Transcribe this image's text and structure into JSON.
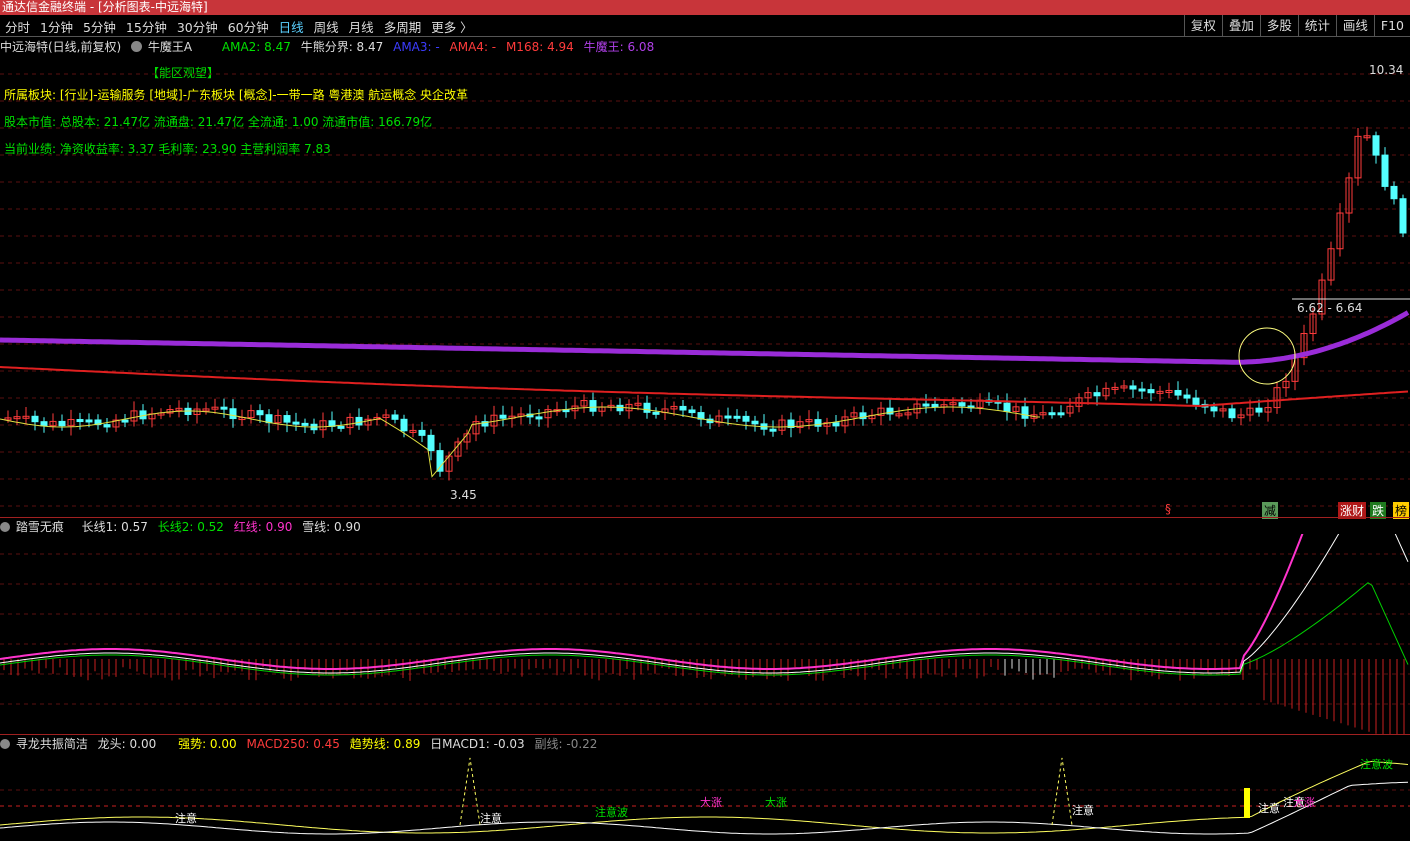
{
  "window": {
    "title": "通达信金融终端 - [分析图表-中远海特]"
  },
  "periods": [
    "分时",
    "1分钟",
    "5分钟",
    "15分钟",
    "30分钟",
    "60分钟",
    "日线",
    "周线",
    "月线",
    "多周期",
    "更多 〉"
  ],
  "active_period": "日线",
  "tools": [
    "复权",
    "叠加",
    "多股",
    "统计",
    "画线",
    "F10"
  ],
  "main_legend": {
    "stock": "中远海特(日线,前复权)",
    "indicator_icon": "circle-chevron-icon",
    "indicator": "牛魔王A",
    "ama2": "AMA2: 8.47",
    "bull_line": "牛熊分界: 8.47",
    "ama3": "AMA3: -",
    "ama4": "AMA4: -",
    "m168": "M168: 4.94",
    "niumowang": "牛魔王: 6.08"
  },
  "info": {
    "tag": "【能区观望】",
    "sector": "所属板块: [行业]-运输服务 [地域]-广东板块 [概念]-一带一路 粤港澳 航运概念 央企改革",
    "capital": "股本市值: 总股本: 21.47亿 流通盘: 21.47亿 全流通: 1.00 流通市值: 166.79亿",
    "performance": "当前业绩:  净资收益率: 3.37 毛利率: 23.90 主营利润率 7.83"
  },
  "annotations": {
    "high": "10.34",
    "low": "3.45",
    "range": "6.62 - 6.64",
    "marker_s": "§",
    "badge_jian": "减",
    "badge_zhangcai": "涨财",
    "badge_die": "跌",
    "badge_bang": "榜"
  },
  "ind1": {
    "name": "踏雪无痕",
    "l1": "长线1: 0.57",
    "l2": "长线2: 0.52",
    "red": "红线: 0.90",
    "snow": "雪线: 0.90"
  },
  "ind2": {
    "name": "寻龙共振简洁",
    "longhead": "龙头: 0.00",
    "strong": "强势: 0.00",
    "macd250": "MACD250: 0.45",
    "trend": "趋势线: 0.89",
    "dmacd": "日MACD1: -0.03",
    "sub": "副线: -0.22",
    "labels": [
      "注意",
      "注意",
      "注意",
      "注意",
      "注意",
      "大涨",
      "大涨",
      "大涨",
      "注意波",
      "注意波"
    ]
  },
  "colors": {
    "title_bg": "#c8353a",
    "up": "#ff3b3b",
    "down": "#54ffff",
    "purple": "#9a2cd8",
    "yellow": "#ffff00",
    "magenta": "#ff33cc"
  }
}
